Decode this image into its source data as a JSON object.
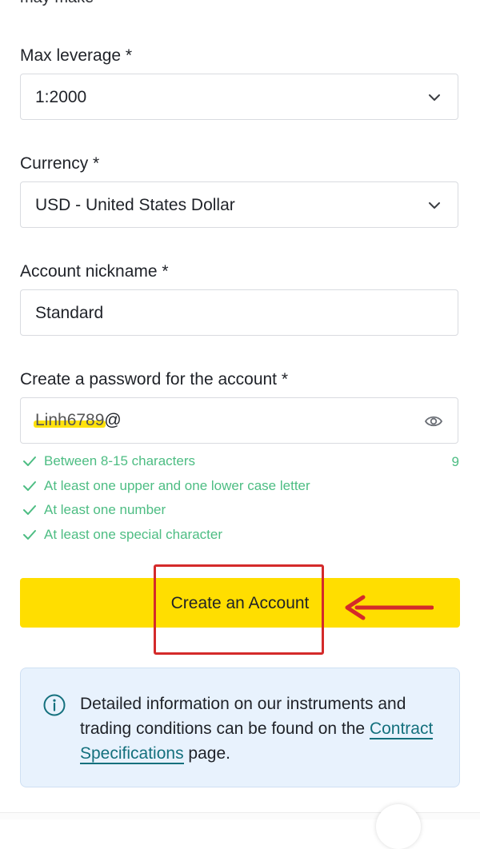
{
  "top_cut_text": "may make",
  "fields": {
    "leverage": {
      "label": "Max leverage *",
      "value": "1:2000"
    },
    "currency": {
      "label": "Currency *",
      "value": "USD - United States Dollar"
    },
    "nickname": {
      "label": "Account nickname *",
      "value": "Standard"
    },
    "password": {
      "label": "Create a password for the account *",
      "masked_value": "Linh6789",
      "suffix": "@"
    }
  },
  "password_rules": [
    "Between 8-15 characters",
    "At least one upper and one lower case letter",
    "At least one number",
    "At least one special character"
  ],
  "password_length": "9",
  "cta": {
    "label": "Create an Account"
  },
  "info": {
    "text_before": "Detailed information on our instruments and trading conditions can be found on the ",
    "link": "Contract Specifications",
    "text_after": " page."
  },
  "colors": {
    "cta_bg": "#ffde00",
    "rule_ok": "#4dbd83",
    "link": "#14707d",
    "info_bg": "#e8f2fd",
    "annotation": "#d42a2a"
  },
  "icons": {
    "chevron": "chevron-down-icon",
    "eye": "eye-icon",
    "check": "check-icon",
    "info": "info-icon",
    "arrow": "arrow-left-icon"
  }
}
